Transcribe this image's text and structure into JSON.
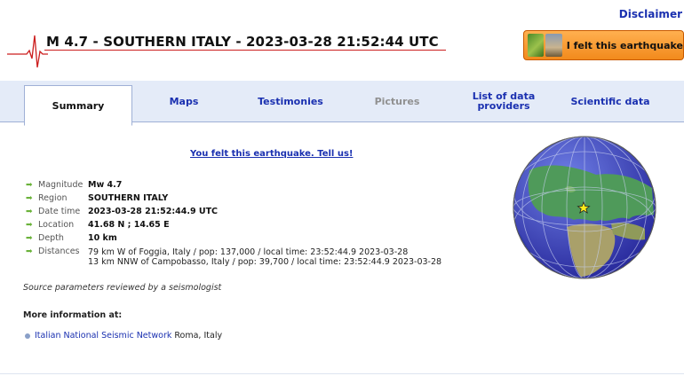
{
  "header": {
    "disclaimer": "Disclaimer",
    "title": "M 4.7 - SOUTHERN ITALY - 2023-03-28 21:52:44 UTC",
    "felt_button": "I felt this earthquake"
  },
  "tabs": [
    {
      "label": "Summary",
      "state": "active"
    },
    {
      "label": "Maps",
      "state": "normal"
    },
    {
      "label": "Testimonies",
      "state": "normal"
    },
    {
      "label": "Pictures",
      "state": "disabled"
    },
    {
      "label": "List of data providers",
      "state": "normal"
    },
    {
      "label": "Scientific data",
      "state": "normal"
    }
  ],
  "tell_us": "You felt this earthquake. Tell us!",
  "params": [
    {
      "label": "Magnitude",
      "value": "Mw 4.7"
    },
    {
      "label": "Region",
      "value": "SOUTHERN ITALY"
    },
    {
      "label": "Date time",
      "value": "2023-03-28 21:52:44.9 UTC"
    },
    {
      "label": "Location",
      "value": "41.68 N ; 14.65 E"
    },
    {
      "label": "Depth",
      "value": "10 km"
    }
  ],
  "distances": {
    "label": "Distances",
    "lines": [
      "79 km W of Foggia, Italy / pop: 137,000 / local time: 23:52:44.9 2023-03-28",
      "13 km NNW of Campobasso, Italy / pop: 39,700 / local time: 23:52:44.9 2023-03-28"
    ]
  },
  "reviewed": "Source parameters reviewed by a seismologist",
  "more_info": {
    "heading": "More information at:",
    "network_name": "Italian National Seismic Network",
    "network_location": "Roma, Italy"
  },
  "colors": {
    "link": "#1a30b0",
    "tab_bg": "#e4ebf8",
    "felt_button": "#f28a1c",
    "arrow": "#6ab23a",
    "title_underline": "#cc1e1e"
  }
}
